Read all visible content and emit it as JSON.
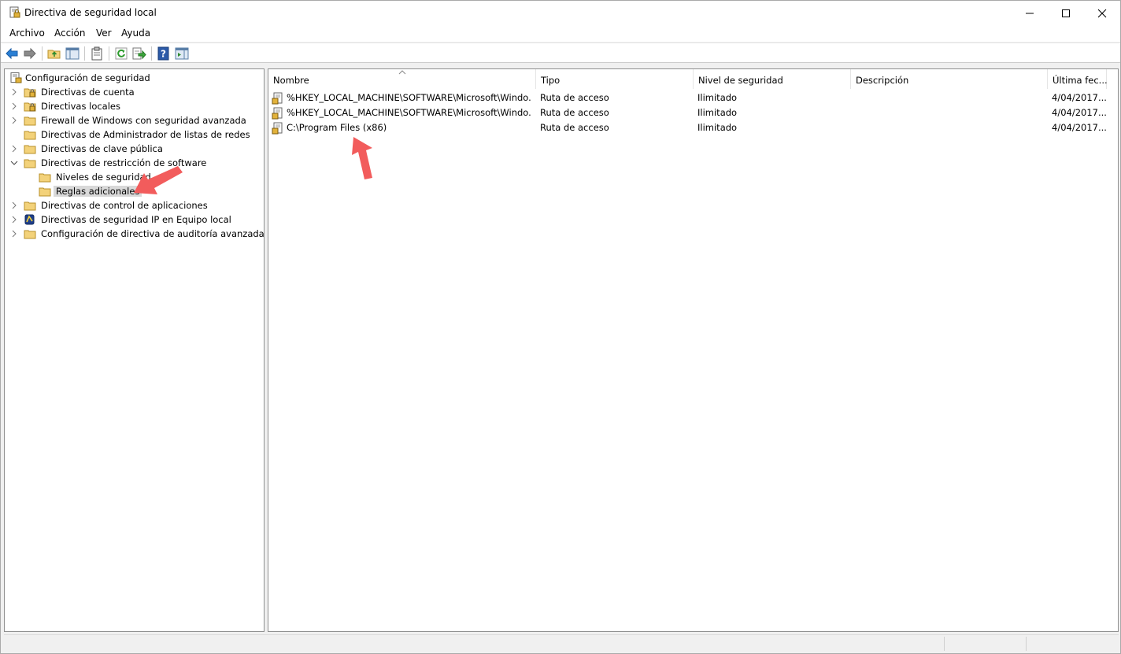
{
  "window": {
    "title": "Directiva de seguridad local"
  },
  "menu": [
    "Archivo",
    "Acción",
    "Ver",
    "Ayuda"
  ],
  "tree": {
    "root": "Configuración de seguridad",
    "items": [
      {
        "label": "Directivas de cuenta",
        "icon": "lock-folder-icon",
        "expander": "collapsed"
      },
      {
        "label": "Directivas locales",
        "icon": "lock-folder-icon",
        "expander": "collapsed"
      },
      {
        "label": "Firewall de Windows con seguridad avanzada",
        "icon": "folder-icon",
        "expander": "collapsed"
      },
      {
        "label": "Directivas de Administrador de listas de redes",
        "icon": "folder-icon",
        "expander": "none"
      },
      {
        "label": "Directivas de clave pública",
        "icon": "folder-icon",
        "expander": "collapsed"
      },
      {
        "label": "Directivas de restricción de software",
        "icon": "folder-icon",
        "expander": "expanded"
      },
      {
        "label": "Niveles de seguridad",
        "icon": "folder-icon",
        "expander": "none",
        "child": true
      },
      {
        "label": "Reglas adicionales",
        "icon": "folder-icon",
        "expander": "none",
        "child": true,
        "selected": true
      },
      {
        "label": "Directivas de control de aplicaciones",
        "icon": "folder-icon",
        "expander": "collapsed"
      },
      {
        "label": "Directivas de seguridad IP en Equipo local",
        "icon": "ip-security-icon",
        "expander": "collapsed"
      },
      {
        "label": "Configuración de directiva de auditoría avanzada",
        "icon": "folder-icon",
        "expander": "collapsed"
      }
    ]
  },
  "list": {
    "columns": [
      "Nombre",
      "Tipo",
      "Nivel de seguridad",
      "Descripción",
      "Última fec..."
    ],
    "rows": [
      {
        "name": "%HKEY_LOCAL_MACHINE\\SOFTWARE\\Microsoft\\Windo...",
        "type": "Ruta de acceso",
        "level": "Ilimitado",
        "description": "",
        "date": "4/04/2017..."
      },
      {
        "name": "%HKEY_LOCAL_MACHINE\\SOFTWARE\\Microsoft\\Windo...",
        "type": "Ruta de acceso",
        "level": "Ilimitado",
        "description": "",
        "date": "4/04/2017..."
      },
      {
        "name": "C:\\Program Files (x86)",
        "type": "Ruta de acceso",
        "level": "Ilimitado",
        "description": "",
        "date": "4/04/2017..."
      }
    ]
  },
  "colors": {
    "annotation_arrow": "#f25c5c",
    "folder": "#f3d27a",
    "selection": "#d9d9d9"
  }
}
